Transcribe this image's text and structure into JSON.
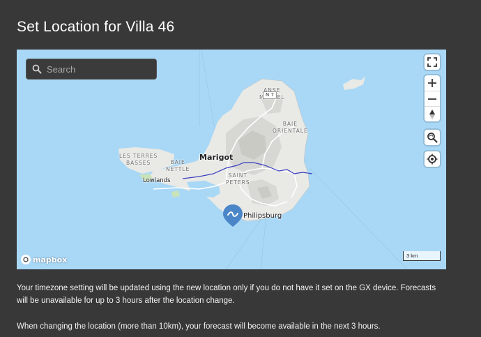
{
  "page": {
    "title": "Set Location for Villa 46"
  },
  "map": {
    "search_placeholder": "Search",
    "controls": {
      "fullscreen_icon": "fullscreen-icon",
      "zoom_in_icon": "plus-icon",
      "zoom_out_icon": "minus-icon",
      "compass_icon": "compass-icon",
      "search_location_icon": "magnify-reset-icon",
      "locate_icon": "crosshair-icon"
    },
    "labels": {
      "anse_marcel": [
        "ANSE",
        "MARCEL"
      ],
      "baie_orientale": [
        "BAIE",
        "ORIENTALE"
      ],
      "les_terres_basses": [
        "LES TERRES",
        "BASSES"
      ],
      "baie_nettle": [
        "BAIE",
        "NETTLE"
      ],
      "saint_peters": [
        "SAINT",
        "PETERS"
      ],
      "marigot": "Marigot",
      "lowlands": "Lowlands",
      "philipsburg": "Philipsburg",
      "route": "N 7"
    },
    "scale": "3 km",
    "brand": "mapbox",
    "colors": {
      "water": "#a9d8f6",
      "land": "#e9e9e6",
      "marker": "#4a86c8"
    }
  },
  "notes": {
    "line1": "Your timezone setting will be updated using the new location only if you do not have it set on the GX device. Forecasts will be unavailable for up to 3 hours after the location change.",
    "line2": "When changing the location (more than 10km), your forecast will become available in the next 3 hours."
  }
}
